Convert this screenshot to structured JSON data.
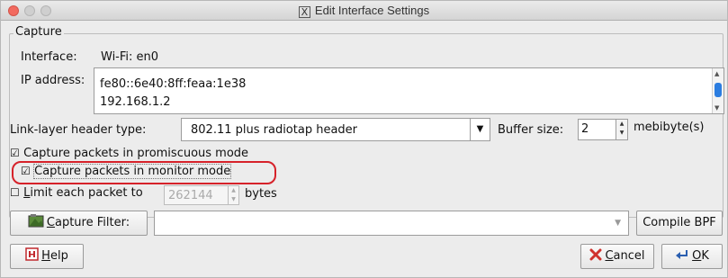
{
  "window": {
    "title": "Edit Interface Settings",
    "title_icon": "x-icon"
  },
  "capture": {
    "group_label": "Capture",
    "interface_label": "Interface:",
    "interface_value": "Wi-Fi: en0",
    "ip_label": "IP address:",
    "ip_addresses": [
      "fe80::6e40:8ff:feaa:1e38",
      "192.168.1.2"
    ],
    "link_layer_label": "Link-layer header type:",
    "link_layer_value": "802.11 plus radiotap header",
    "buffer_label": "Buffer size:",
    "buffer_value": "2",
    "buffer_unit": "mebibyte(s)",
    "promiscuous_label": "Capture packets in promiscuous mode",
    "promiscuous_checked": true,
    "monitor_label": "Capture packets in monitor mode",
    "monitor_checked": true,
    "limit_prefix": "imit each packet to",
    "limit_mnemonic": "L",
    "limit_checked": false,
    "limit_value": "262144",
    "limit_suffix": "bytes"
  },
  "filter": {
    "button_mnemonic": "C",
    "button_rest": "apture Filter:",
    "input_value": "",
    "compile_label": "Compile BPF"
  },
  "footer": {
    "help_mnemonic": "H",
    "help_rest": "elp",
    "cancel_mnemonic": "C",
    "cancel_rest": "ancel",
    "ok_mnemonic": "O",
    "ok_rest": "K"
  },
  "colors": {
    "highlight": "#d6222a",
    "scroll_thumb": "#2b7de0"
  }
}
